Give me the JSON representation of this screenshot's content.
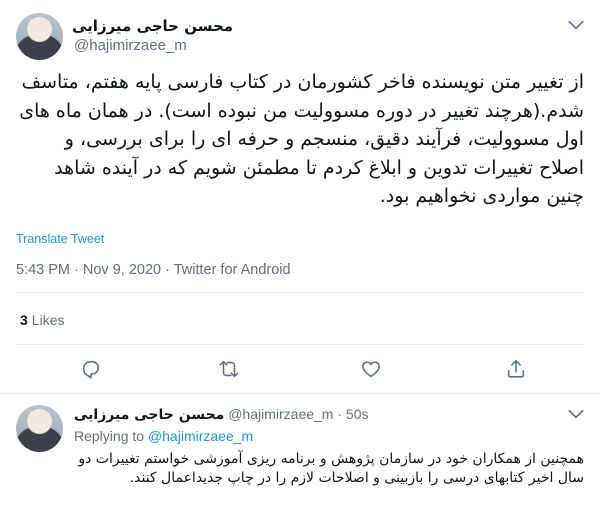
{
  "main_tweet": {
    "display_name": "محسن حاجی میرزایی",
    "handle": "@hajimirzaee_m",
    "text": "از تغییر متن نویسنده فاخر کشورمان در کتاب فارسی پایه هفتم، متاسف شدم.(هرچند تغییر در دوره مسوولیت من نبوده است). در همان ماه های اول مسوولیت، فرآیند دقیق، منسجم و حرفه ای را برای بررسی، و اصلاح تغییرات تدوین و ابلاغ کردم تا مطمئن شویم که در آینده شاهد چنین مواردی نخواهیم بود.",
    "translate_label": "Translate Tweet",
    "meta": "5:43 PM · Nov 9, 2020 · Twitter for Android",
    "likes_count": "3",
    "likes_label": "Likes"
  },
  "icons": {
    "caret": "chevron-down-icon",
    "reply": "reply-icon",
    "retweet": "retweet-icon",
    "like": "heart-icon",
    "share": "share-icon"
  },
  "reply_tweet": {
    "display_name": "محسن حاجی میرزایی",
    "handle": "@hajimirzaee_m",
    "time": "50s",
    "replying_prefix": "Replying to",
    "replying_handle": "@hajimirzaee_m",
    "text": "همچنین از همکاران خود در سازمان پژوهش و برنامه ریزی آموزشی خواستم تغییرات دو سال اخیر کتابهای درسی را بازبینی و اصلاحات لازم را در چاپ جدیداعمال کنند."
  },
  "colors": {
    "link": "#1b95e0",
    "secondary_text": "#5b7083",
    "divider": "#e6ecf0"
  }
}
